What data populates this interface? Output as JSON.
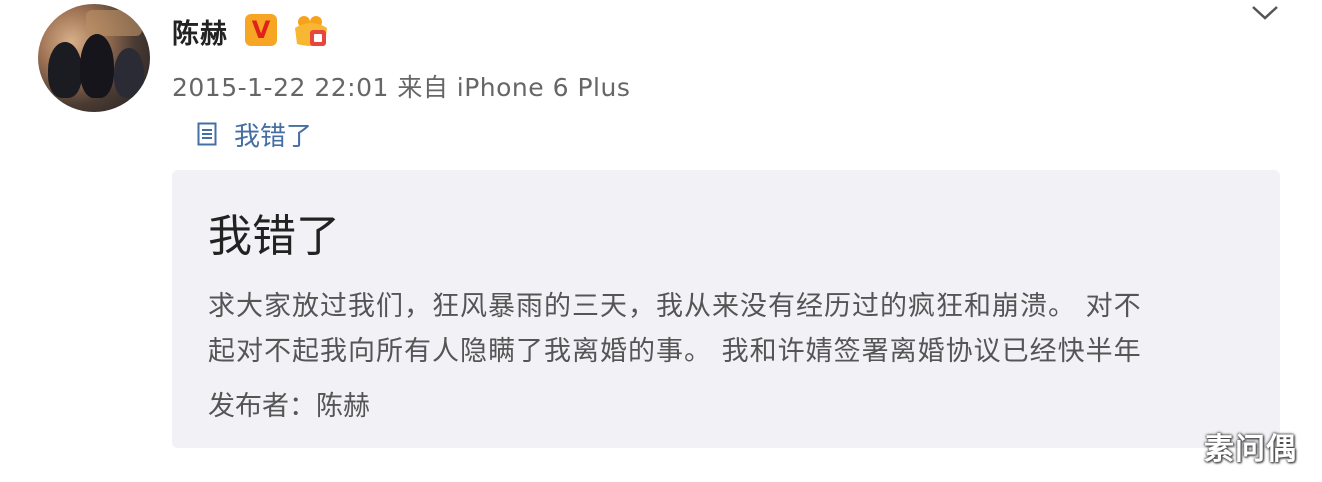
{
  "post": {
    "author": "陈赫",
    "vip_badge": "V",
    "timestamp": "2015-1-22 22:01",
    "source": "来自 iPhone 6 Plus",
    "article_link": "我错了"
  },
  "card": {
    "title": "我错了",
    "summary_lines": [
      "求大家放过我们，狂风暴雨的三天，我从来没有经历过的疯狂和崩溃。 对不",
      "起对不起我向所有人隐瞒了我离婚的事。 我和许婧签署离婚协议已经快半年"
    ],
    "author_label": "发布者：陈赫"
  },
  "watermark": "素问偶",
  "colors": {
    "link": "#456fa3",
    "card_bg": "#f2f2f6",
    "vip_badge": "#f6a623"
  },
  "icons": [
    "chevron-down-icon",
    "article-icon",
    "vip-badge-icon",
    "level-badge-icon"
  ]
}
